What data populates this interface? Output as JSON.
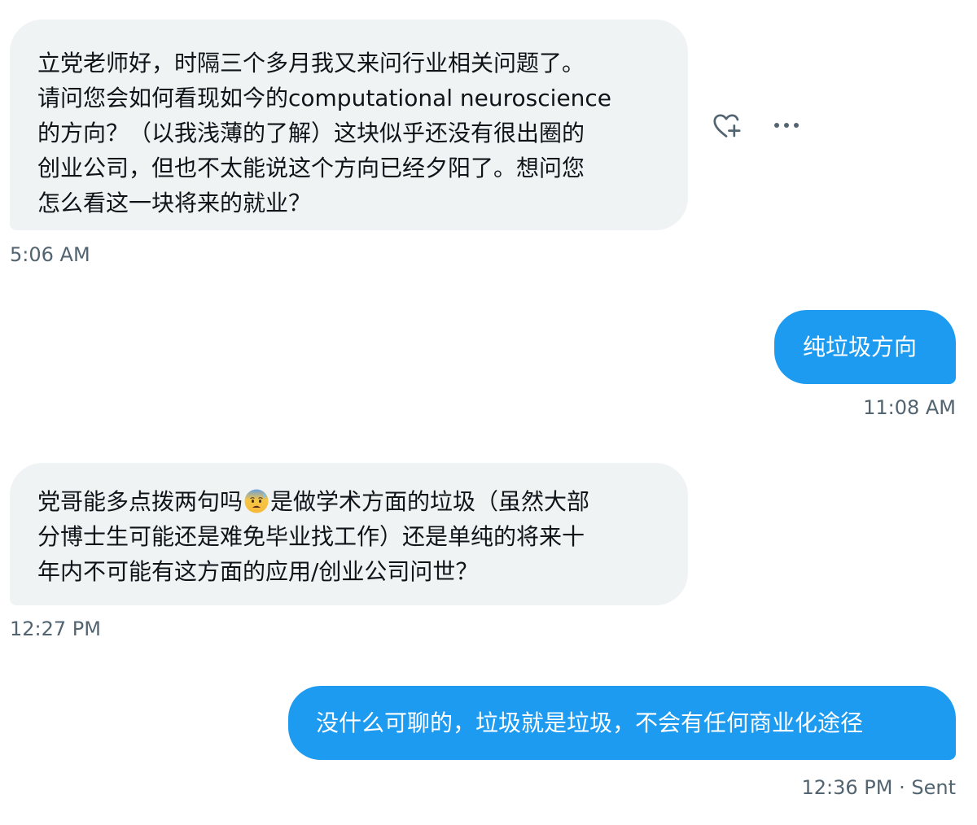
{
  "messages": [
    {
      "direction": "received",
      "lines": [
        "立党老师好，时隔三个多月我又来问行业相关问题了。",
        "请问您会如何看现如今的computational neuroscience",
        "的方向？（以我浅薄的了解）这块似乎还没有很出圈的",
        "创业公司，但也不太能说这个方向已经夕阳了。想问您",
        "怎么看这一块将来的就业？"
      ],
      "time": "5:06 AM"
    },
    {
      "direction": "sent",
      "text": "纯垃圾方向",
      "time": "11:08 AM"
    },
    {
      "direction": "received",
      "line1_before_emoji": "党哥能多点拨两句吗",
      "emoji": "anxious-face-with-sweat",
      "line1_after_emoji": "是做学术方面的垃圾（虽然大部",
      "line2": "分博士生可能还是难免毕业找工作）还是单纯的将来十",
      "line3": "年内不可能有这方面的应用/创业公司问世？",
      "time": "12:27 PM"
    },
    {
      "direction": "sent",
      "text": "没什么可聊的，垃圾就是垃圾，不会有任何商业化途径",
      "time": "12:36 PM · Sent"
    }
  ],
  "actions": {
    "react_icon": "heart-plus-icon",
    "more_icon": "more-horizontal-icon"
  },
  "colors": {
    "sent_bubble": "#1d9bf0",
    "received_bubble": "#eff3f4",
    "timestamp": "#536471",
    "text": "#0f1419"
  }
}
